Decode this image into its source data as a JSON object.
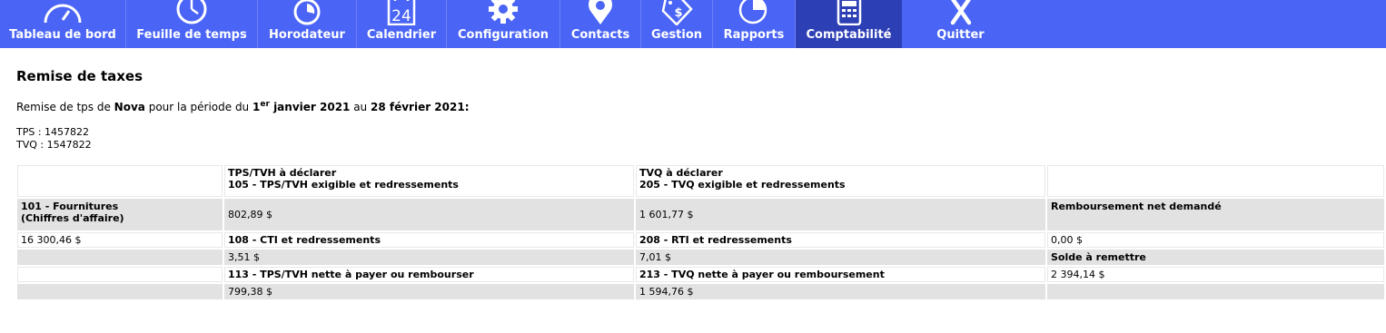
{
  "nav": {
    "items": [
      {
        "label": "Tableau de bord",
        "icon": "gauge-icon"
      },
      {
        "label": "Feuille de temps",
        "icon": "clock-icon"
      },
      {
        "label": "Horodateur",
        "icon": "stopwatch-icon"
      },
      {
        "label": "Calendrier",
        "icon": "calendar-icon",
        "icon_text": "24"
      },
      {
        "label": "Configuration",
        "icon": "gear-icon"
      },
      {
        "label": "Contacts",
        "icon": "location-pin-icon"
      },
      {
        "label": "Gestion",
        "icon": "price-tag-dollar-icon"
      },
      {
        "label": "Rapports",
        "icon": "pie-chart-icon"
      },
      {
        "label": "Comptabilité",
        "icon": "calculator-icon",
        "active": true
      },
      {
        "label": "Quitter",
        "icon": "close-x-icon"
      }
    ],
    "colors": {
      "bar": "#4a64f5",
      "active": "#2d3fb5",
      "text": "#ffffff"
    }
  },
  "page": {
    "title": "Remise de taxes",
    "period": {
      "prefix": "Remise de tps de ",
      "company": "Nova",
      "middle": " pour la période du ",
      "start_day": "1",
      "start_sup": "er",
      "start_rest": " janvier 2021",
      "connector": " au ",
      "end": "28 février 2021:"
    },
    "tps_line": "TPS : 1457822",
    "tvq_line": "TVQ : 1547822"
  },
  "table": {
    "header": {
      "tps_title": "TPS/TVH à déclarer",
      "tps_sub": "105 - TPS/TVH exigible et redressements",
      "tvq_title": "TVQ à déclarer",
      "tvq_sub": "205 - TVQ exigible et redressements"
    },
    "r1": {
      "label1": "101 - Fournitures",
      "label2": "(Chiffres d'affaire)",
      "tps": "802,89 $",
      "tvq": "1 601,77 $",
      "extra": "Remboursement net demandé"
    },
    "r2": {
      "label": "16 300,46 $",
      "tps": "108 - CTI et redressements",
      "tvq": "208 - RTI et redressements",
      "extra": "0,00 $"
    },
    "r3": {
      "label": "",
      "tps": "3,51 $",
      "tvq": "7,01 $",
      "extra": "Solde à remettre"
    },
    "r4": {
      "label": "",
      "tps": "113 - TPS/TVH nette à payer ou rembourser",
      "tvq": "213 - TVQ nette à payer ou remboursement",
      "extra": "2 394,14 $"
    },
    "r5": {
      "label": "",
      "tps": "799,38 $",
      "tvq": "1 594,76 $",
      "extra": ""
    }
  }
}
